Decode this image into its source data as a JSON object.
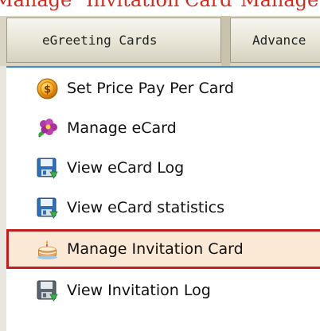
{
  "banner": {
    "cut_text_parts": [
      "Manage",
      "Invitation",
      "Card",
      "Manage"
    ]
  },
  "tabs": [
    {
      "label": "eGreeting Cards"
    },
    {
      "label": "Advance"
    }
  ],
  "menu": {
    "items": [
      {
        "label": "Set Price Pay Per Card",
        "icon": "coin-icon"
      },
      {
        "label": "Manage eCard",
        "icon": "flower-icon"
      },
      {
        "label": "View eCard Log",
        "icon": "floppy-disk-icon"
      },
      {
        "label": "View eCard statistics",
        "icon": "floppy-disk-icon"
      },
      {
        "label": "Manage Invitation Card",
        "icon": "cake-icon",
        "selected": true
      },
      {
        "label": "View Invitation Log",
        "icon": "floppy-disk-icon"
      }
    ]
  },
  "colors": {
    "selection_border": "#c01f1f",
    "cut_text": "#d22a1e",
    "tabbar_background": "#d9d4c3"
  }
}
